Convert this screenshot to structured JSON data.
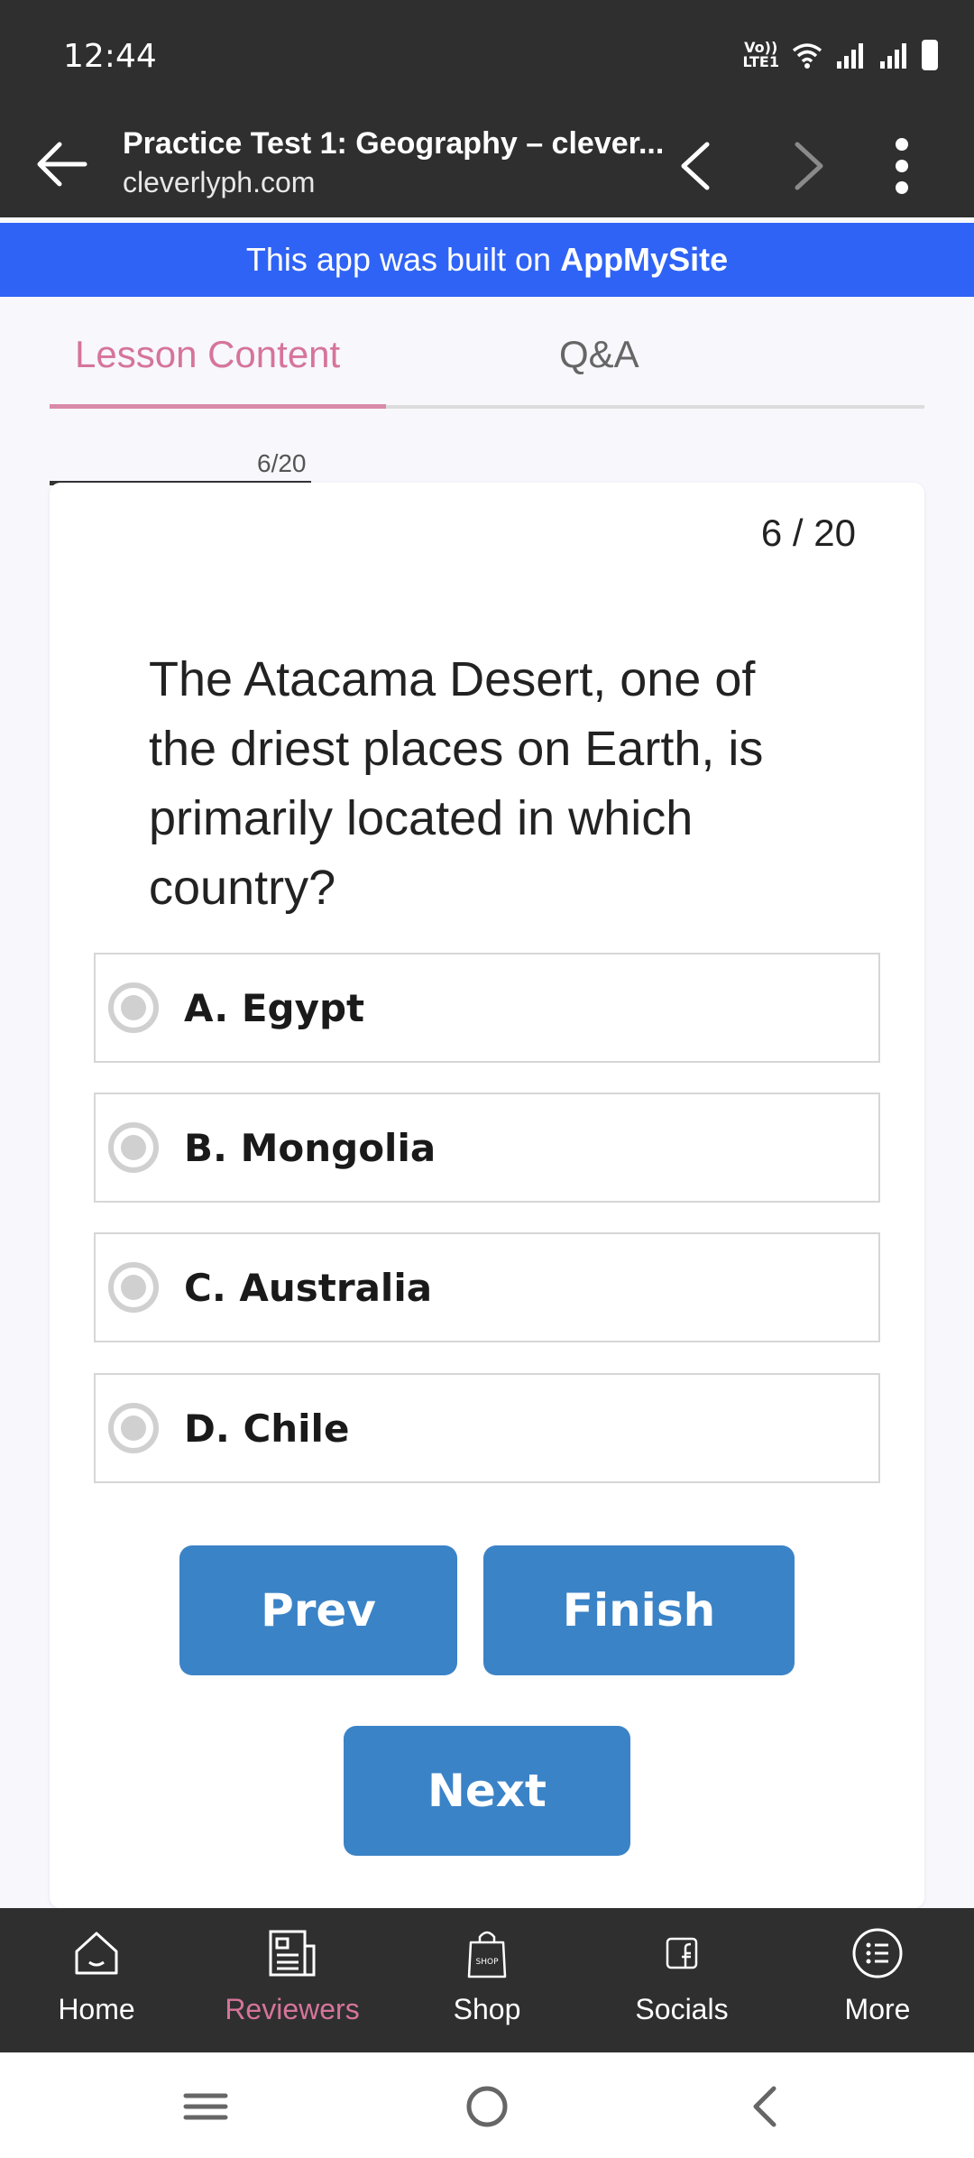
{
  "status_bar": {
    "time": "12:44",
    "volte_top": "Vo))",
    "volte_bottom": "LTE1"
  },
  "browser": {
    "title": "Practice Test 1: Geography – clever...",
    "url": "cleverlyph.com"
  },
  "banner": {
    "prefix": "This app was built on",
    "brand": "AppMySite"
  },
  "tabs": [
    {
      "label": "Lesson Content",
      "active": true
    },
    {
      "label": "Q&A",
      "active": false
    }
  ],
  "progress": {
    "label": "6/20",
    "current": 6,
    "total": 20
  },
  "quiz": {
    "counter": "6 / 20",
    "question": "The Atacama Desert, one of the driest places on Earth, is primarily located in which country?",
    "options": [
      {
        "label": "A. Egypt"
      },
      {
        "label": "B. Mongolia"
      },
      {
        "label": "C. Australia"
      },
      {
        "label": "D. Chile"
      }
    ],
    "buttons": {
      "prev": "Prev",
      "finish": "Finish",
      "next": "Next"
    }
  },
  "bottom_nav": [
    {
      "label": "Home",
      "icon": "home-icon",
      "active": false
    },
    {
      "label": "Reviewers",
      "icon": "newspaper-icon",
      "active": true
    },
    {
      "label": "Shop",
      "icon": "shop-bag-icon",
      "active": false,
      "icon_text": "SHOP"
    },
    {
      "label": "Socials",
      "icon": "facebook-icon",
      "active": false
    },
    {
      "label": "More",
      "icon": "list-icon",
      "active": false
    }
  ],
  "colors": {
    "accent": "#d6749a",
    "banner": "#2f63f6",
    "button": "#3b83c7",
    "bar": "#2f2f2f"
  }
}
